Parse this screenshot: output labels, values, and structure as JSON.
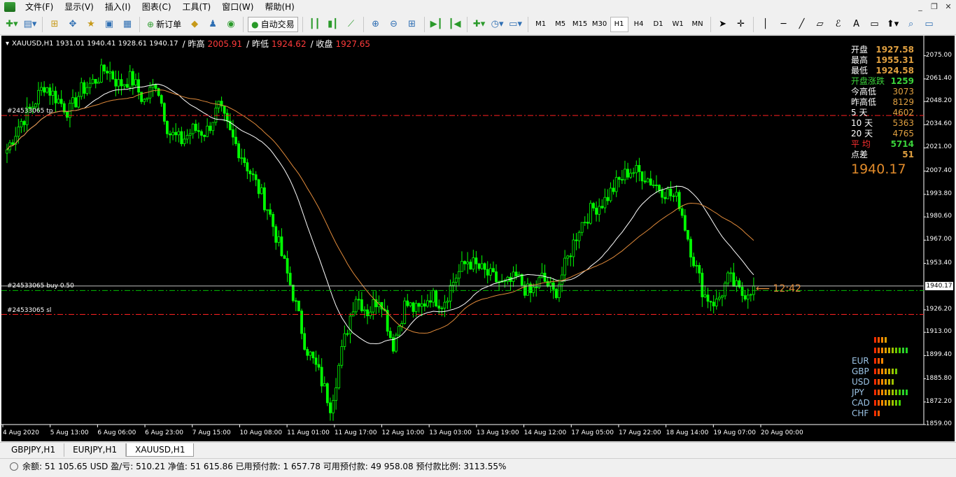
{
  "menu": {
    "items": [
      "文件(F)",
      "显示(V)",
      "插入(I)",
      "图表(C)",
      "工具(T)",
      "窗口(W)",
      "帮助(H)"
    ]
  },
  "toolbar": {
    "new_order": "新订单",
    "auto_trade": "自动交易",
    "timeframes": [
      "M1",
      "M5",
      "M15",
      "M30",
      "H1",
      "H4",
      "D1",
      "W1",
      "MN"
    ],
    "active_timeframe": "H1"
  },
  "chart": {
    "symbol_line": "XAUUSD,H1  1931.01 1940.41 1928.61 1940.17",
    "stats": [
      {
        "label": "/ 昨高",
        "value": "2005.91"
      },
      {
        "label": "/ 昨低",
        "value": "1924.62"
      },
      {
        "label": "/ 收盘",
        "value": "1927.65"
      }
    ],
    "order_labels": {
      "tp": "#24533065 tp",
      "buy": "#24533065 buy 0.50",
      "sl": "#24533065 sl"
    },
    "timer": "12:42",
    "current_price": "1940.17",
    "colors": {
      "bull": "#00ff00",
      "bear": "#00ff00",
      "ma_fast": "#ffffff",
      "ma_slow": "#e08a3a",
      "order_line": "#ff2020",
      "entry_line": "#00c000"
    }
  },
  "stats_panel": {
    "rows": [
      {
        "label": "开盘",
        "value": "1927.58",
        "label_color": "#ffffff",
        "value_color": "#e0a040"
      },
      {
        "label": "最高",
        "value": "1955.31",
        "label_color": "#ffffff",
        "value_color": "#e0a040"
      },
      {
        "label": "最低",
        "value": "1924.58",
        "label_color": "#ffffff",
        "value_color": "#e0a040"
      },
      {
        "label": "开盘涨跌",
        "value": "1259",
        "label_color": "#3ad23a",
        "value_color": "#3ad23a"
      },
      {
        "label": "今高低",
        "value": "3073",
        "label_color": "#ffffff",
        "value_color": "#e0a040"
      },
      {
        "label": "昨高低",
        "value": "8129",
        "label_color": "#ffffff",
        "value_color": "#e0a040"
      },
      {
        "label": "5  天",
        "value": "4602",
        "label_color": "#ffffff",
        "value_color": "#e0a040"
      },
      {
        "label": "10 天",
        "value": "5363",
        "label_color": "#ffffff",
        "value_color": "#e0a040"
      },
      {
        "label": "20 天",
        "value": "4765",
        "label_color": "#ffffff",
        "value_color": "#e0a040"
      },
      {
        "label": "平 均",
        "value": "5714",
        "label_color": "#ff3030",
        "value_color": "#3ad23a"
      },
      {
        "label": "点差",
        "value": "51",
        "label_color": "#ffffff",
        "value_color": "#e0a040"
      }
    ],
    "big_price": "1940.17"
  },
  "currency_panel": {
    "rows": [
      {
        "name": "",
        "bars": 4
      },
      {
        "name": "",
        "bars": 10
      },
      {
        "name": "EUR",
        "bars": 3
      },
      {
        "name": "GBP",
        "bars": 7
      },
      {
        "name": "USD",
        "bars": 6
      },
      {
        "name": "JPY",
        "bars": 10
      },
      {
        "name": "CAD",
        "bars": 8
      },
      {
        "name": "CHF",
        "bars": 2
      }
    ]
  },
  "chart_data": {
    "type": "candlestick",
    "symbol": "XAUUSD",
    "timeframe": "H1",
    "y_ticks": [
      "2075.00",
      "2061.40",
      "2048.20",
      "2034.60",
      "2021.00",
      "2007.40",
      "1993.80",
      "1980.60",
      "1967.00",
      "1953.40",
      "1940.17",
      "1926.20",
      "1913.00",
      "1899.40",
      "1885.80",
      "1872.20",
      "1859.00"
    ],
    "ylim": [
      1859.0,
      2081.0
    ],
    "x_ticks": [
      "4 Aug 2020",
      "5 Aug 13:00",
      "6 Aug 06:00",
      "6 Aug 23:00",
      "7 Aug 15:00",
      "10 Aug 08:00",
      "11 Aug 01:00",
      "11 Aug 17:00",
      "12 Aug 10:00",
      "13 Aug 03:00",
      "13 Aug 19:00",
      "14 Aug 12:00",
      "17 Aug 05:00",
      "17 Aug 22:00",
      "18 Aug 14:00",
      "19 Aug 07:00",
      "20 Aug 00:00"
    ],
    "order_levels": {
      "tp": 2040.0,
      "entry": 1937.5,
      "sl": 1923.5
    },
    "last_price": 1940.17,
    "close_path": [
      2020,
      2035,
      2045,
      2058,
      2050,
      2042,
      2055,
      2060,
      2068,
      2058,
      2062,
      2048,
      2060,
      2030,
      2025,
      2032,
      2030,
      2045,
      2028,
      2015,
      2000,
      1985,
      1960,
      1935,
      1905,
      1890,
      1870,
      1905,
      1935,
      1925,
      1935,
      1905,
      1930,
      1925,
      1935,
      1930,
      1945,
      1955,
      1950,
      1945,
      1940,
      1945,
      1935,
      1945,
      1935,
      1955,
      1975,
      1985,
      1990,
      2000,
      2008,
      2006,
      2000,
      1995,
      1990,
      1960,
      1935,
      1930,
      1945,
      1935,
      1940
    ]
  },
  "tabs": [
    "GBPJPY,H1",
    "EURJPY,H1",
    "XAUUSD,H1"
  ],
  "active_tab": "XAUUSD,H1",
  "status": {
    "text": "余额: 51 105.65 USD  盈/亏: 510.21  净值: 51 615.86  已用预付款: 1 657.78  可用预付款: 49 958.08  预付款比例: 3113.55%"
  }
}
